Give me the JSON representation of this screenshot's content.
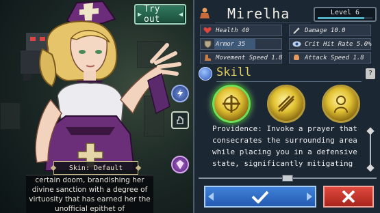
{
  "buttons": {
    "try_out": "Try out"
  },
  "character": {
    "name": "Mirelha",
    "level": "Level 6",
    "level_progress": 0.85
  },
  "stats": [
    {
      "label": "Health 40",
      "icon": "heart-icon",
      "fill": 0.0
    },
    {
      "label": "Damage 10.0",
      "icon": "sword-icon",
      "fill": 0.0
    },
    {
      "label": "Armor 35",
      "icon": "shield-icon",
      "fill": 0.6
    },
    {
      "label": "Crit Hit Rate 5.0%",
      "icon": "eye-icon",
      "fill": 0.0
    },
    {
      "label": "Movement Speed 1.8",
      "icon": "boot-icon",
      "fill": 0.0
    },
    {
      "label": "Attack Speed 1.8",
      "icon": "fist-icon",
      "fill": 0.0
    }
  ],
  "skill_section": {
    "title": "Skill",
    "help_icon": "?",
    "skills": [
      {
        "icon": "providence-skill-icon",
        "selected": true
      },
      {
        "icon": "radiant-skill-icon",
        "selected": false
      },
      {
        "icon": "saint-skill-icon",
        "selected": false
      }
    ],
    "description": "Providence: Invoke a prayer that consecrates the surrounding area while placing you in a defensive state, significantly mitigating all damage dealt to you and"
  },
  "skin": {
    "label": "Skin: Default"
  },
  "lore": {
    "text": "certain doom, brandishing her divine sanction with a degree of virtuosity that has earned her the unofficial epithet of"
  },
  "colors": {
    "accent_green": "#6ee05a",
    "confirm_blue": "#3f82d8",
    "cancel_red": "#e04a3e",
    "skill_gold": "#e7cf5c"
  }
}
